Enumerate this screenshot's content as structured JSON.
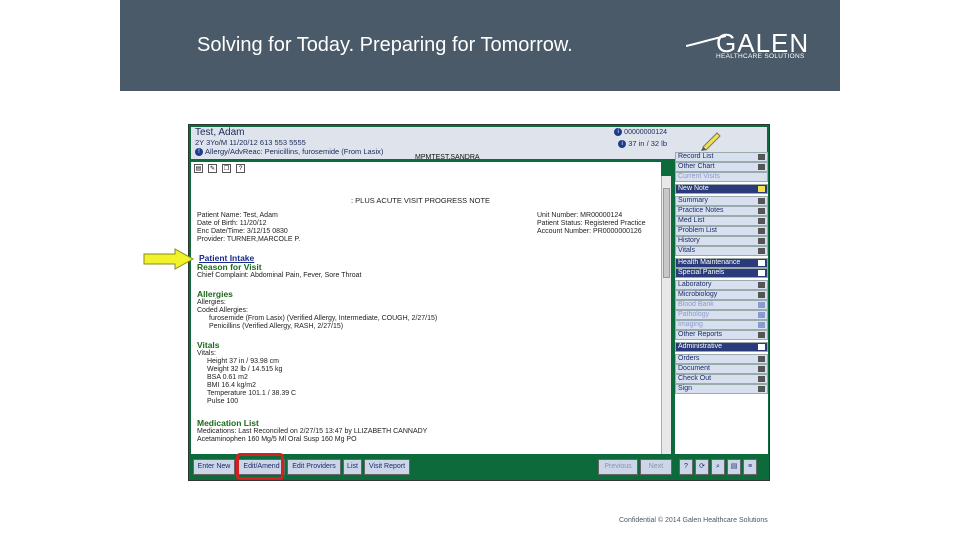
{
  "header": {
    "tagline": "Solving for Today. Preparing for Tomorrow.",
    "logo_word": "GALEN",
    "logo_sub": "HEALTHCARE SOLUTIONS",
    "bg_color": "#4a5a68"
  },
  "patient_bar": {
    "name": "Test, Adam",
    "line2": "2Y 3Yo/M 11/20/12 613 553 5555",
    "line3": "Allergy/AdvReac: Penicillins, furosemide (From Lasix)",
    "account": "00000000124",
    "height_weight": "37 in / 32 lb",
    "user": "MPMTEST,SANDRA"
  },
  "toolbar_icons": [
    "print-icon",
    "edit-icon",
    "copy-icon",
    "help-icon"
  ],
  "document": {
    "title": ": PLUS ACUTE VISIT PROGRESS NOTE",
    "patient_name": "Patient Name: Test, Adam",
    "dob": "Date of Birth: 11/20/12",
    "enc": "Enc Date/Time: 3/12/15 0830",
    "provider": "Provider: TURNER,MARCOLE P.",
    "unit_number": "Unit Number: MR00000124",
    "patient_status": "Patient Status: Registered Practice",
    "account_number": "Account Number: PR0000000126",
    "patient_intake": "Patient Intake",
    "reason_heading": "Reason for Visit",
    "chief_complaint": "Chief Complaint: Abdominal Pain, Fever, Sore Throat",
    "allergies_heading": "Allergies",
    "allergies_label": "Allergies:",
    "coded_allergies": "Coded Allergies:",
    "allergy1": "furosemide (From Lasix) (Verified Allergy, Intermediate, COUGH, 2/27/15)",
    "allergy2": "Penicillins (Verified Allergy, RASH, 2/27/15)",
    "vitals_heading": "Vitals",
    "vitals_label": "Vitals:",
    "height": "Height 37 in / 93.98 cm",
    "weight": "Weight 32 lb / 14.515 kg",
    "bsa": "BSA 0.61 m2",
    "bmi": "BMI 16.4 kg/m2",
    "temperature": "Temperature 101.1 / 38.39 C",
    "pulse": "Pulse 100",
    "med_heading": "Medication List",
    "medications": "Medications:    Last Reconciled on 2/27/15 13:47 by LLIZABETH CANNADY",
    "med1": "Acetaminophen 160 Mg/5 Ml Oral Susp 160 Mg PO"
  },
  "sidebar": {
    "items": [
      {
        "label": "Record List",
        "style": "normal"
      },
      {
        "label": "Other Chart",
        "style": "normal"
      },
      {
        "label": "Current Visits",
        "style": "dim"
      },
      {
        "label": "New Note",
        "style": "dark"
      },
      {
        "label": "Summary",
        "style": "normal"
      },
      {
        "label": "Practice Notes",
        "style": "normal"
      },
      {
        "label": "Med List",
        "style": "normal"
      },
      {
        "label": "Problem List",
        "style": "normal"
      },
      {
        "label": "History",
        "style": "normal"
      },
      {
        "label": "Vitals",
        "style": "normal"
      },
      {
        "label": "Health Maintenance",
        "style": "dark"
      },
      {
        "label": "Special Panels",
        "style": "dark"
      },
      {
        "label": "Laboratory",
        "style": "normal"
      },
      {
        "label": "Microbiology",
        "style": "normal"
      },
      {
        "label": "Blood Bank",
        "style": "dim"
      },
      {
        "label": "Pathology",
        "style": "dim"
      },
      {
        "label": "Imaging",
        "style": "dim"
      },
      {
        "label": "Other Reports",
        "style": "normal"
      },
      {
        "label": "Administrative",
        "style": "dark"
      },
      {
        "label": "Orders",
        "style": "normal"
      },
      {
        "label": "Document",
        "style": "normal"
      },
      {
        "label": "Check Out",
        "style": "normal"
      },
      {
        "label": "Sign",
        "style": "normal"
      }
    ]
  },
  "bottom_buttons": {
    "enter_new": "Enter New",
    "edit_amend": "Edit/Amend",
    "edit_providers": "Edit Providers",
    "list": "List",
    "visit_report": "Visit Report",
    "previous": "Previous",
    "next": "Next"
  },
  "footer": "Confidential © 2014 Galen Healthcare Solutions",
  "colors": {
    "highlight_box": "#d42020",
    "arrow": "#f2f22a",
    "app_green": "#0d6a3a"
  }
}
